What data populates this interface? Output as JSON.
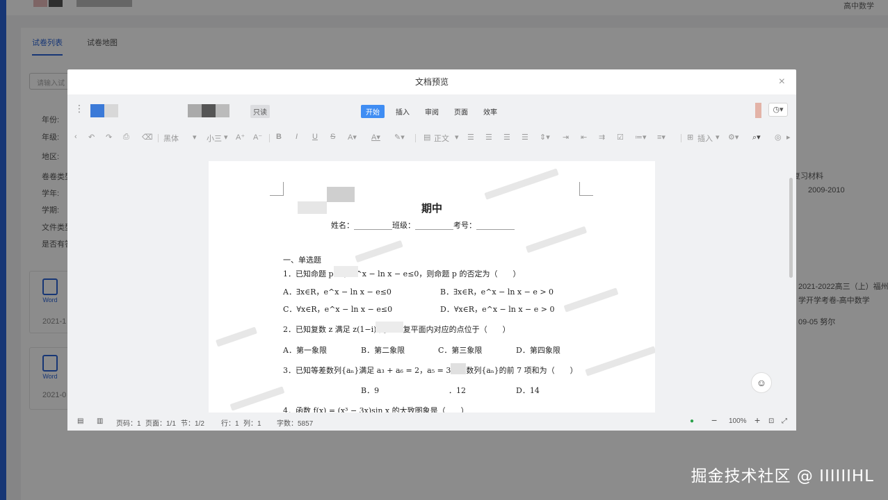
{
  "background": {
    "top_right": "高中数学",
    "tabs": [
      "试卷列表",
      "试卷地图"
    ],
    "search_placeholder": "请输入试",
    "filters": [
      "年份:",
      "年级:",
      "地区:",
      "卷卷类型",
      "学年:",
      "学期:",
      "文件类型",
      "是否有答"
    ],
    "right_texts": {
      "material": "复习材料",
      "year_range": "2009-2010",
      "card_title": "2021-2022高三（上）福州",
      "card_sub": "学开学考卷-高中数学",
      "card_meta": "09-05  努尔"
    },
    "cards": [
      {
        "icon_label": "Word",
        "date": "2021-1"
      },
      {
        "icon_label": "Word",
        "date": "2021-0"
      }
    ]
  },
  "modal": {
    "title": "文档预览",
    "close": "×",
    "readonly_badge": "只读",
    "menu_tabs": [
      "开始",
      "插入",
      "审阅",
      "页面",
      "效率"
    ],
    "active_tab": "开始",
    "toolbar": {
      "font": "黑体",
      "size": "小三",
      "paragraph": "正文",
      "insert": "插入"
    }
  },
  "document": {
    "title": "期中",
    "info_line": "姓名：__________班级：__________考号：__________",
    "section": "一、单选题",
    "q1": "1．已知命题 p：          ，e^x − ln x − e≤0，则命题 p 的否定为（　　）",
    "q1_options": [
      "A．∃x∈R，e^x − ln x − e≤0",
      "B．∃x∈R，e^x − ln x − e > 0",
      "C．∀x∈R，e^x − ln x − e≤0",
      "D．∀x∈R，e^x − ln x − e > 0"
    ],
    "q2": "2．已知复数 z 满足 z(1−i)          则 z 在复平面内对应的点位于（　　）",
    "q2_options": [
      "A．第一象限",
      "B．第二象限",
      "C．第三象限",
      "D．第四象限"
    ],
    "q3": "3．已知等差数列{aₙ}满足 a₃ + a₆ = 2，a₅ = 3，则数列{aₙ}的前 7 项和为（　　）",
    "q3_options": [
      "B．9",
      "．12",
      "D．14"
    ],
    "q4": "4．函数 f(x) = (x³ − 3x)sin x 的大致图象是（　　）"
  },
  "statusbar": {
    "page_num": "页码：1",
    "page": "页面：1/1",
    "section": "节：1/2",
    "row": "行：1",
    "col": "列：1",
    "words": "字数：5857",
    "zoom": "100%"
  },
  "watermark": "掘金技术社区 @ IIIIIIHL"
}
